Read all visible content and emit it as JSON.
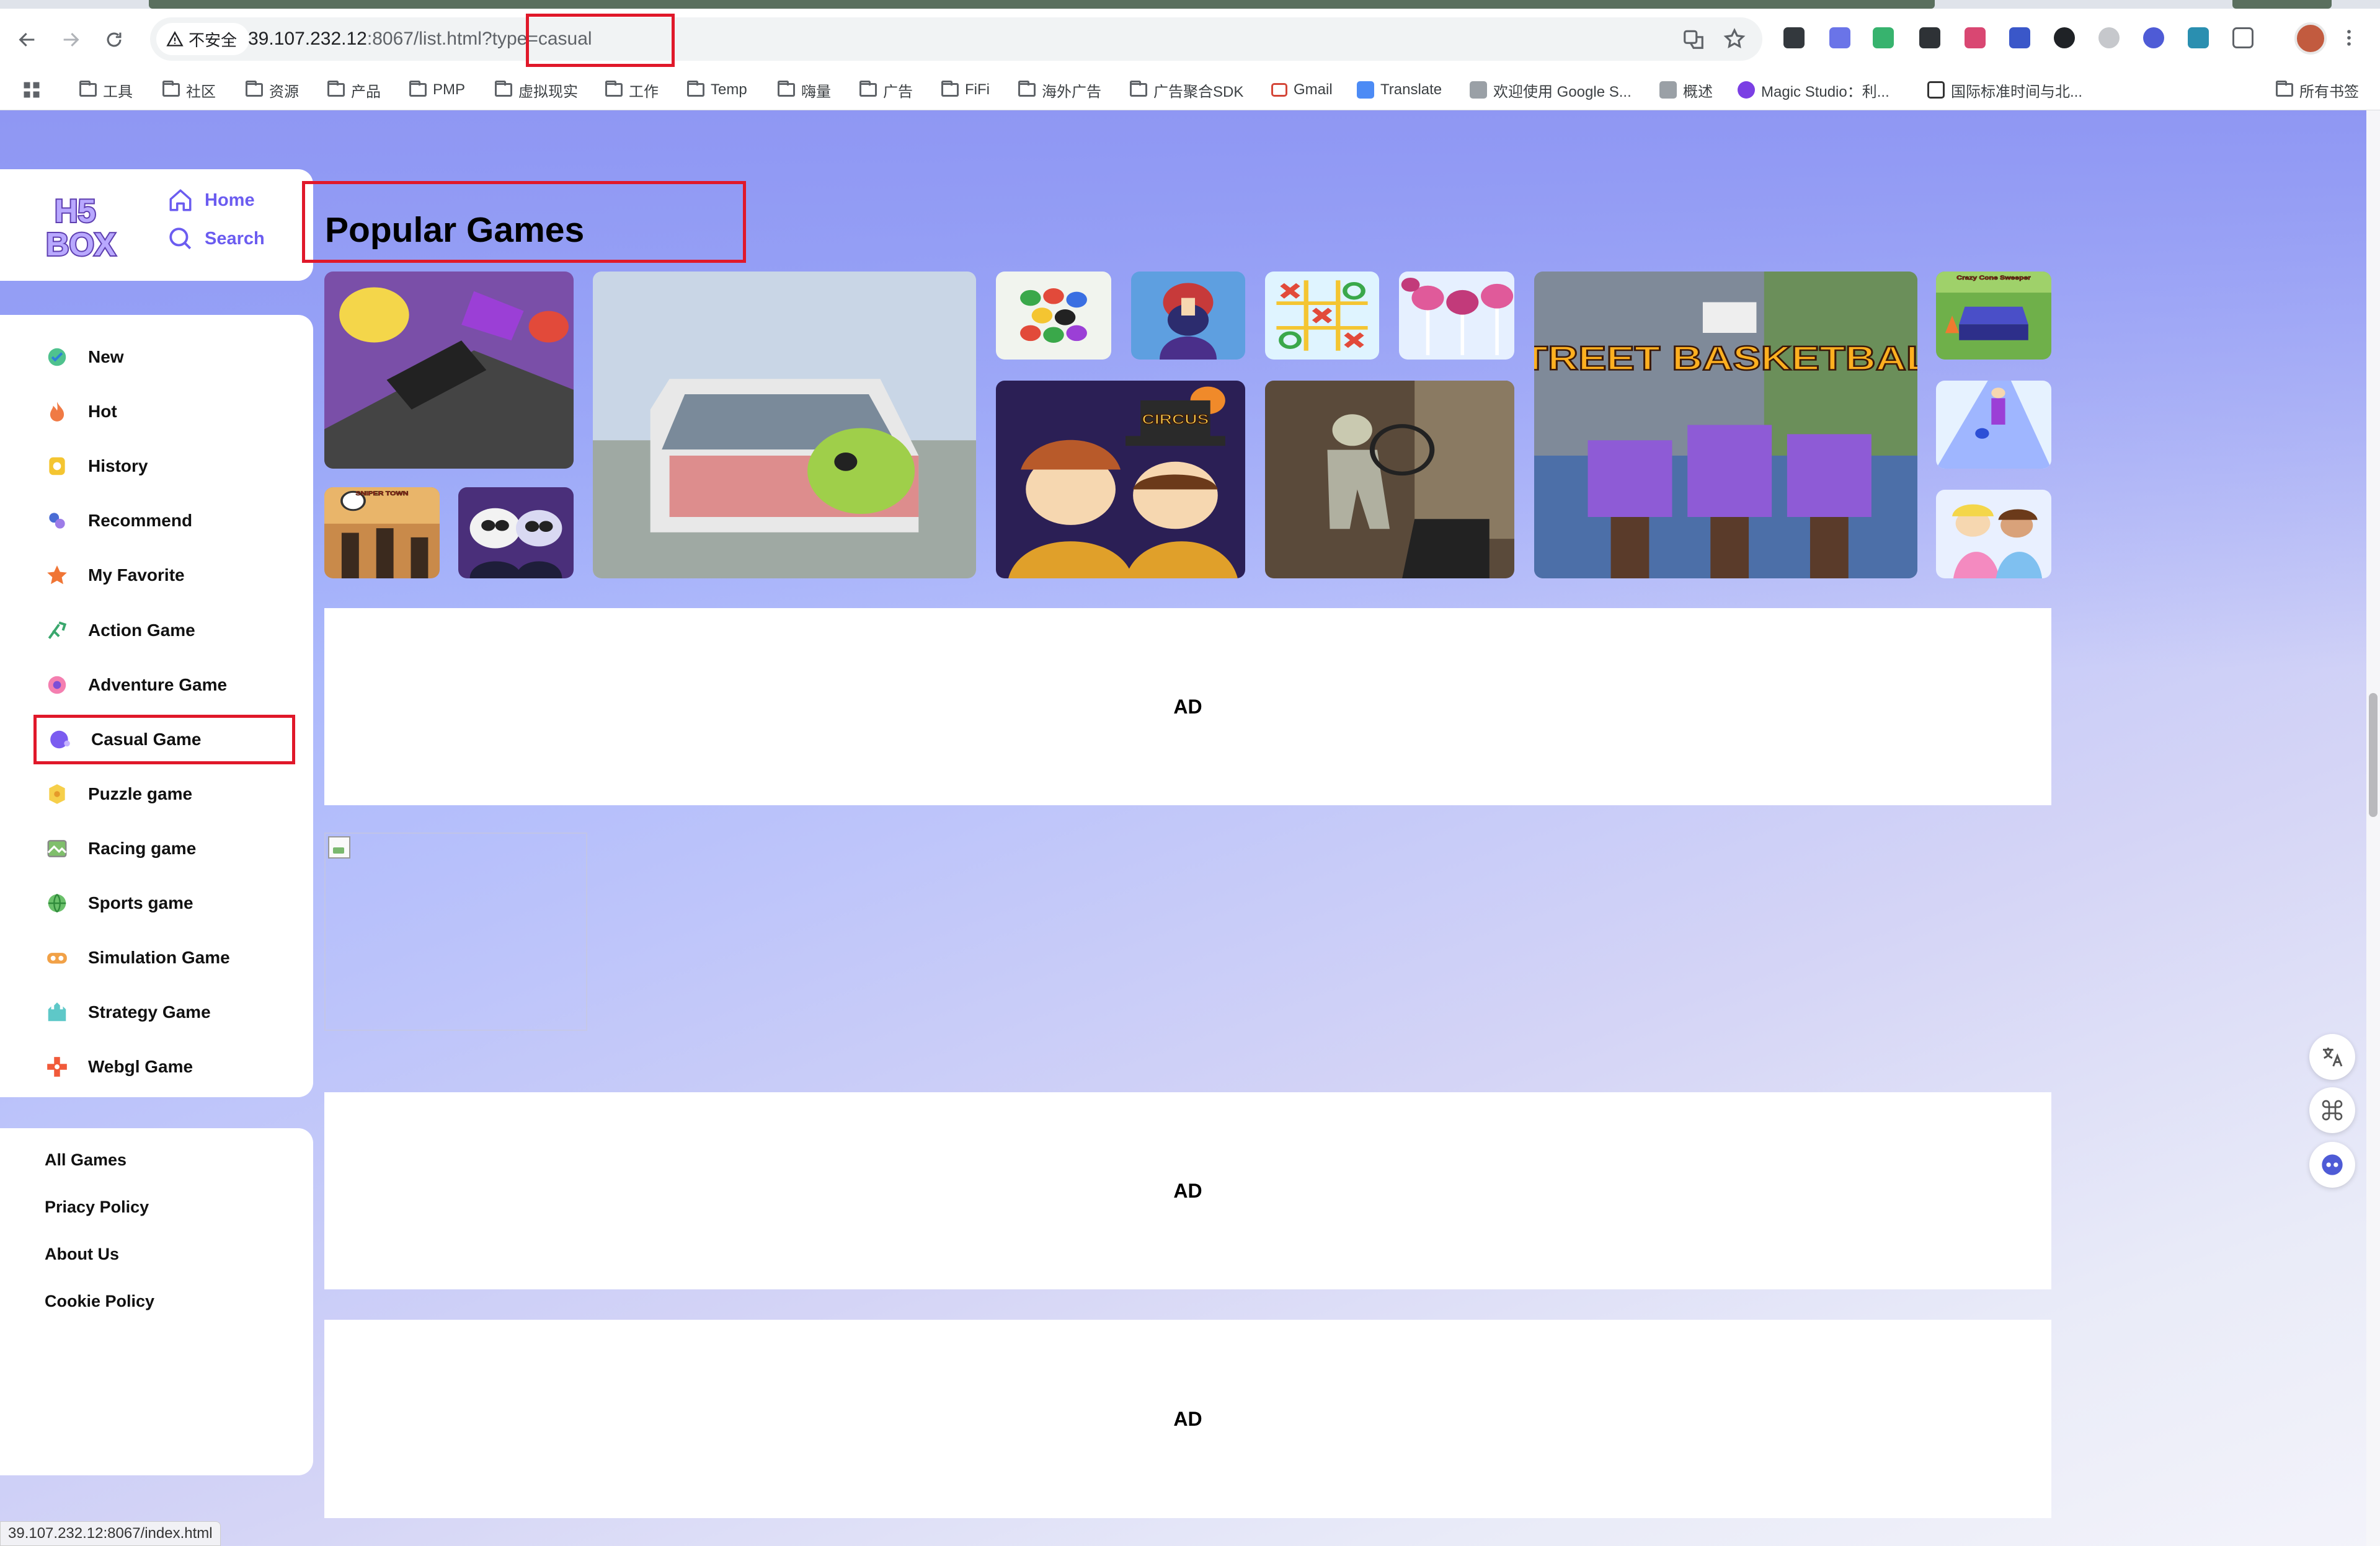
{
  "browser": {
    "security_label": "不安全",
    "url_host": "39.107.232.12",
    "url_rest": ":8067/list.html?type=casual",
    "bookmarks": [
      "工具",
      "社区",
      "资源",
      "产品",
      "PMP",
      "虚拟现实",
      "工作",
      "Temp",
      "嗨量",
      "广告",
      "FiFi",
      "海外广告",
      "广告聚合SDK",
      "Gmail",
      "Translate",
      "欢迎使用 Google S...",
      "概述",
      "Magic Studio：利...",
      "国际标准时间与北...",
      "所有书签"
    ],
    "extensions": [
      "ext-dark",
      "ext-jh",
      "ext-n",
      "ext-card",
      "ext-red",
      "ext-blue",
      "ext-mask",
      "ext-gray",
      "ext-face",
      "ext-m",
      "ext-puzzle"
    ]
  },
  "site": {
    "logo_text": "H5 BOX",
    "home_label": "Home",
    "search_label": "Search",
    "nav": [
      {
        "label": "New",
        "icon": "new-icon"
      },
      {
        "label": "Hot",
        "icon": "fire-icon"
      },
      {
        "label": "History",
        "icon": "history-icon"
      },
      {
        "label": "Recommend",
        "icon": "recommend-icon"
      },
      {
        "label": "My Favorite",
        "icon": "star-icon"
      },
      {
        "label": "Action Game",
        "icon": "action-icon"
      },
      {
        "label": "Adventure Game",
        "icon": "adventure-icon"
      },
      {
        "label": "Casual Game",
        "icon": "casual-icon"
      },
      {
        "label": "Puzzle game",
        "icon": "puzzle-icon"
      },
      {
        "label": "Racing game",
        "icon": "racing-icon"
      },
      {
        "label": "Sports game",
        "icon": "sports-icon"
      },
      {
        "label": "Simulation Game",
        "icon": "simulation-icon"
      },
      {
        "label": "Strategy Game",
        "icon": "strategy-icon"
      },
      {
        "label": "Webgl Game",
        "icon": "webgl-icon"
      }
    ],
    "active_nav": "Casual Game",
    "footer_links": [
      "All Games",
      "Priacy Policy",
      "About Us",
      "Cookie Policy"
    ]
  },
  "main": {
    "section_title": "Popular Games",
    "ad_label": "AD",
    "games": [
      {
        "name": "purple-drill-game",
        "art": "drill"
      },
      {
        "name": "zombie-van-game",
        "art": "van"
      },
      {
        "name": "ball-sort-game",
        "art": "balls"
      },
      {
        "name": "knight-game",
        "art": "knight"
      },
      {
        "name": "tic-tac-toe-game",
        "art": "ttt"
      },
      {
        "name": "lollipop-game",
        "art": "lolli"
      },
      {
        "name": "street-basketball-game",
        "art": "basket",
        "text": "STREET BASKETBALL"
      },
      {
        "name": "crazy-cone-sweeper-game",
        "art": "cone",
        "text": "Crazy Cone Sweeper"
      },
      {
        "name": "sniper-town-game",
        "art": "sniper",
        "text": "SNIPER TOWN"
      },
      {
        "name": "skeleton-couple-game",
        "art": "skel"
      },
      {
        "name": "circus-kids-game",
        "art": "circus",
        "text": "CIRCUS"
      },
      {
        "name": "zombie-shooter-game",
        "art": "zshoot"
      },
      {
        "name": "runner-game",
        "art": "runner"
      },
      {
        "name": "princess-game",
        "art": "princess"
      }
    ]
  },
  "status_url": "39.107.232.12:8067/index.html"
}
